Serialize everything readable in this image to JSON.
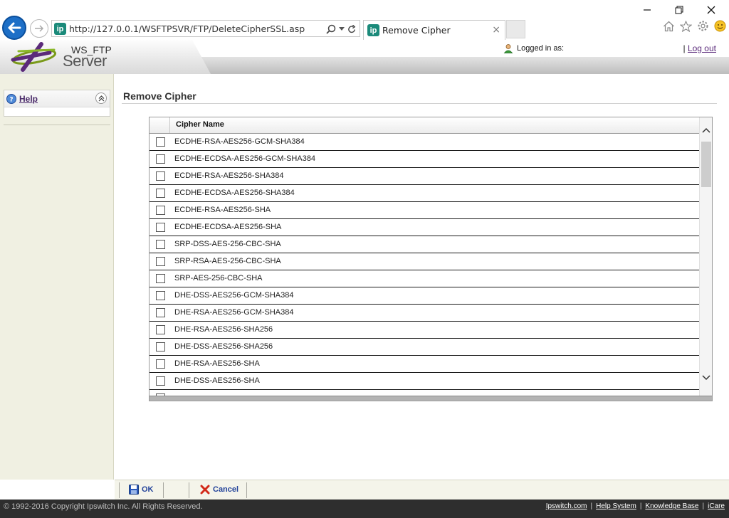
{
  "browser": {
    "url": "http://127.0.0.1/WSFTPSVR/FTP/DeleteCipherSSL.asp",
    "site_icon": "ip",
    "tab_title": "Remove Cipher",
    "tab_close": "×",
    "icons": [
      "back-arrow-icon",
      "forward-arrow-icon",
      "search-icon",
      "dropdown-icon",
      "refresh-icon",
      "home-icon",
      "favorites-star-icon",
      "settings-gear-icon",
      "smiley-icon"
    ]
  },
  "header": {
    "logo_ws": "WS_FTP",
    "logo_server": "Server",
    "logged_in_label": "Logged in as:",
    "logout_sep": "|",
    "logout_label": "Log out"
  },
  "sidebar": {
    "help_label": "Help",
    "collapse_glyph": "⌃"
  },
  "main": {
    "title": "Remove Cipher",
    "column_header": "Cipher Name",
    "ciphers": [
      "ECDHE-RSA-AES256-GCM-SHA384",
      "ECDHE-ECDSA-AES256-GCM-SHA384",
      "ECDHE-RSA-AES256-SHA384",
      "ECDHE-ECDSA-AES256-SHA384",
      "ECDHE-RSA-AES256-SHA",
      "ECDHE-ECDSA-AES256-SHA",
      "SRP-DSS-AES-256-CBC-SHA",
      "SRP-RSA-AES-256-CBC-SHA",
      "SRP-AES-256-CBC-SHA",
      "DHE-DSS-AES256-GCM-SHA384",
      "DHE-RSA-AES256-GCM-SHA384",
      "DHE-RSA-AES256-SHA256",
      "DHE-DSS-AES256-SHA256",
      "DHE-RSA-AES256-SHA",
      "DHE-DSS-AES256-SHA"
    ]
  },
  "actions": {
    "ok_label": "OK",
    "cancel_label": "Cancel"
  },
  "footer": {
    "copyright": "© 1992-2016 Copyright Ipswitch Inc. All Rights Reserved.",
    "links": [
      "Ipswitch.com",
      "Help System",
      "Knowledge Base",
      "iCare"
    ]
  },
  "colors": {
    "accent_blue": "#1d6fc7",
    "site_icon_teal": "#1b8a7a",
    "sidebar_bg": "#f0f0e2",
    "footer_bg": "#2e2e2e",
    "link_purple": "#5a2a7a"
  }
}
